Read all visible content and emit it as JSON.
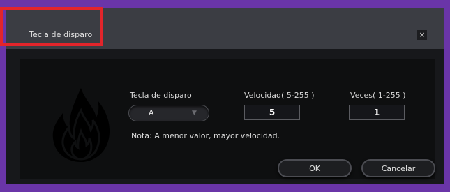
{
  "window": {
    "title": "Tecla de disparo",
    "close_label": "×"
  },
  "form": {
    "trigger_key_label": "Tecla de disparo",
    "trigger_key_value": "A",
    "speed_label": "Velocidad( 5-255 )",
    "speed_value": "5",
    "times_label": "Veces( 1-255 )",
    "times_value": "1",
    "note": "Nota: A menor valor, mayor velocidad."
  },
  "buttons": {
    "ok": "OK",
    "cancel": "Cancelar"
  },
  "icons": {
    "flame": "flame-icon",
    "dropdown": "chevron-down-icon",
    "close": "close-icon"
  },
  "colors": {
    "highlight": "#e2252b",
    "background": "#6a35a8"
  }
}
